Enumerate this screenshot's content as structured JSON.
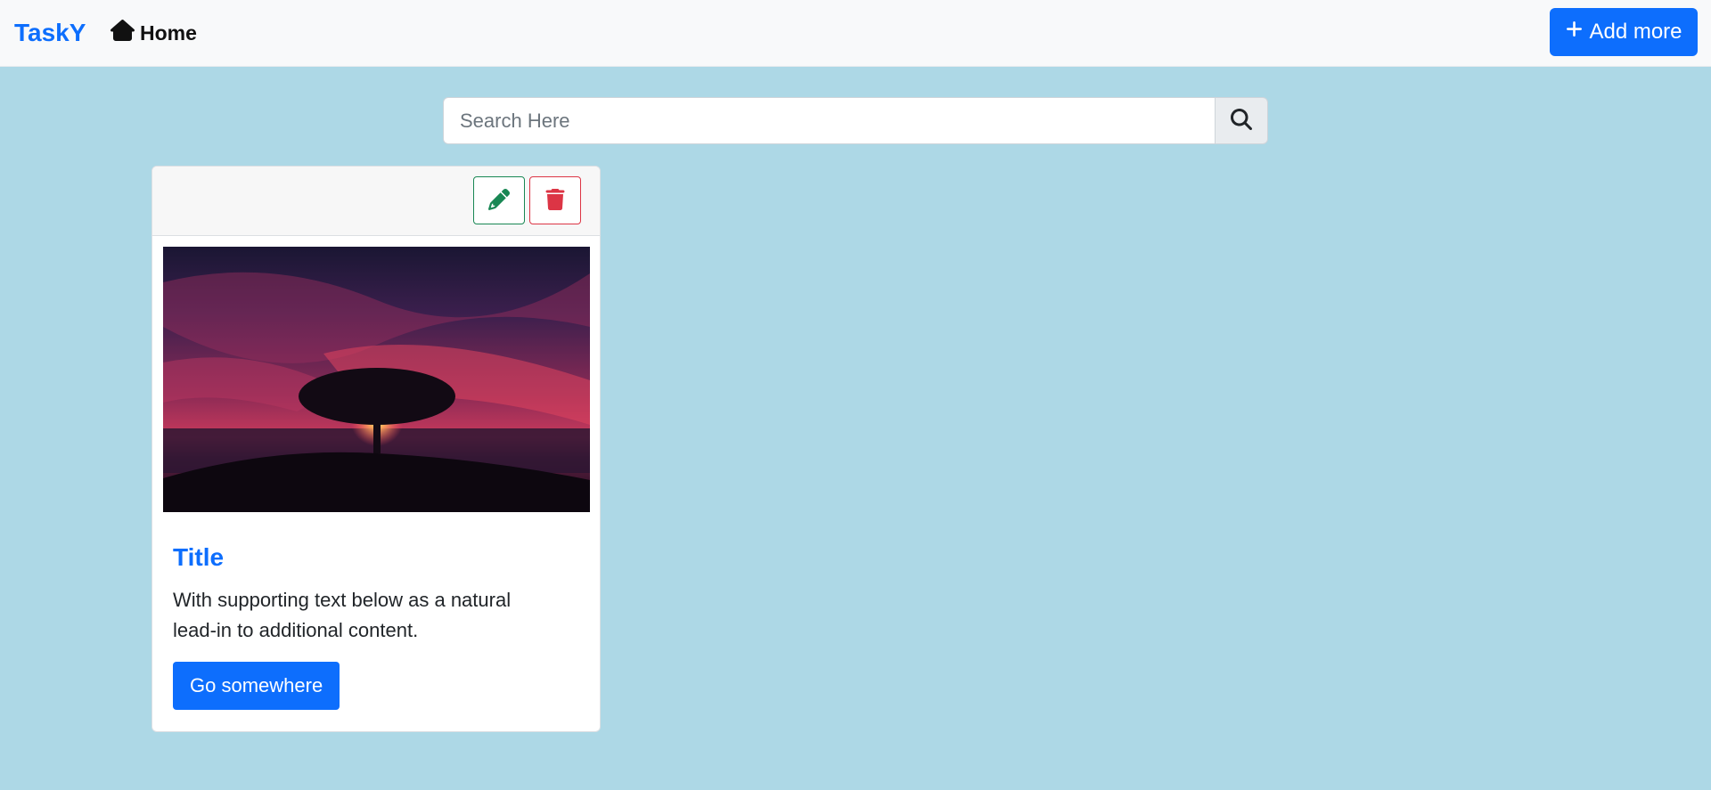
{
  "navbar": {
    "brand": "TaskY",
    "home_label": "Home",
    "add_button_label": "Add more"
  },
  "search": {
    "placeholder": "Search Here",
    "value": ""
  },
  "cards": [
    {
      "title": "Title",
      "text": "With supporting text below as a natural lead-in to additional content.",
      "button_label": "Go somewhere",
      "image": "sunset-tree-over-sea"
    }
  ],
  "icons": {
    "home": "home-icon",
    "add": "plus-icon",
    "search": "search-icon",
    "edit": "pencil-icon",
    "delete": "trash-icon"
  },
  "colors": {
    "background": "#add8e6",
    "navbar": "#f8f9fa",
    "primary": "#0d6efd",
    "success": "#198754",
    "danger": "#dc3545"
  }
}
